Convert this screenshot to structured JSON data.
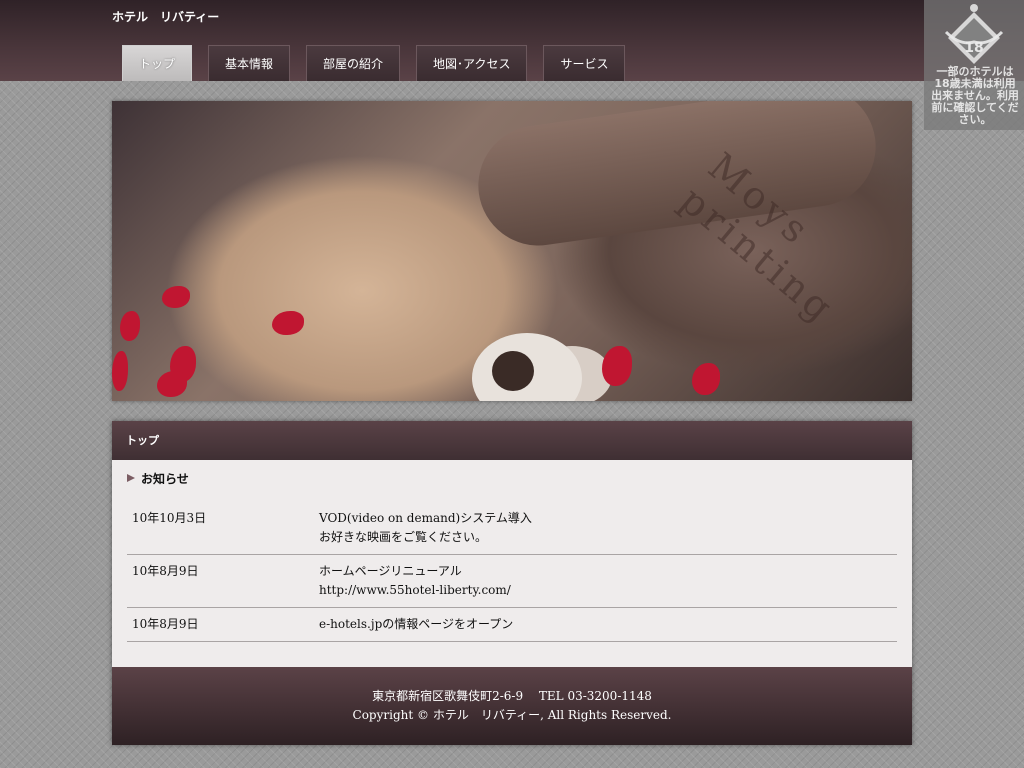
{
  "header": {
    "site_title": "ホテル　リバティー"
  },
  "nav": {
    "tabs": [
      {
        "label": "トップ",
        "active": true
      },
      {
        "label": "基本情報",
        "active": false
      },
      {
        "label": "部屋の紹介",
        "active": false
      },
      {
        "label": "地図･アクセス",
        "active": false
      },
      {
        "label": "サービス",
        "active": false
      }
    ]
  },
  "age_notice": {
    "badge_number": "18",
    "text": "一部のホテルは18歳未満は利用出来ません。利用前に確認してください。",
    "icon": "age-18-restriction-icon"
  },
  "hero": {
    "watermark": "Moys printing"
  },
  "panel": {
    "title": "トップ",
    "section_heading": "お知らせ",
    "news": [
      {
        "date": "10年10月3日",
        "line1": "VOD(video on demand)システム導入",
        "line2": "お好きな映画をご覧ください。"
      },
      {
        "date": "10年8月9日",
        "line1": "ホームページリニューアル",
        "line2": "http://www.55hotel-liberty.com/"
      },
      {
        "date": "10年8月9日",
        "line1": "e-hotels.jpの情報ページをオープン",
        "line2": ""
      }
    ]
  },
  "footer": {
    "address": "東京都新宿区歌舞伎町2-6-9　 TEL 03-3200-1148",
    "copyright": "Copyright © ホテル　リバティー, All Rights Reserved."
  },
  "colors": {
    "header_bg": "#3f2f33",
    "accent": "#7b5d63",
    "body_bg": "#9a9a9a",
    "content_bg": "#efecec"
  }
}
